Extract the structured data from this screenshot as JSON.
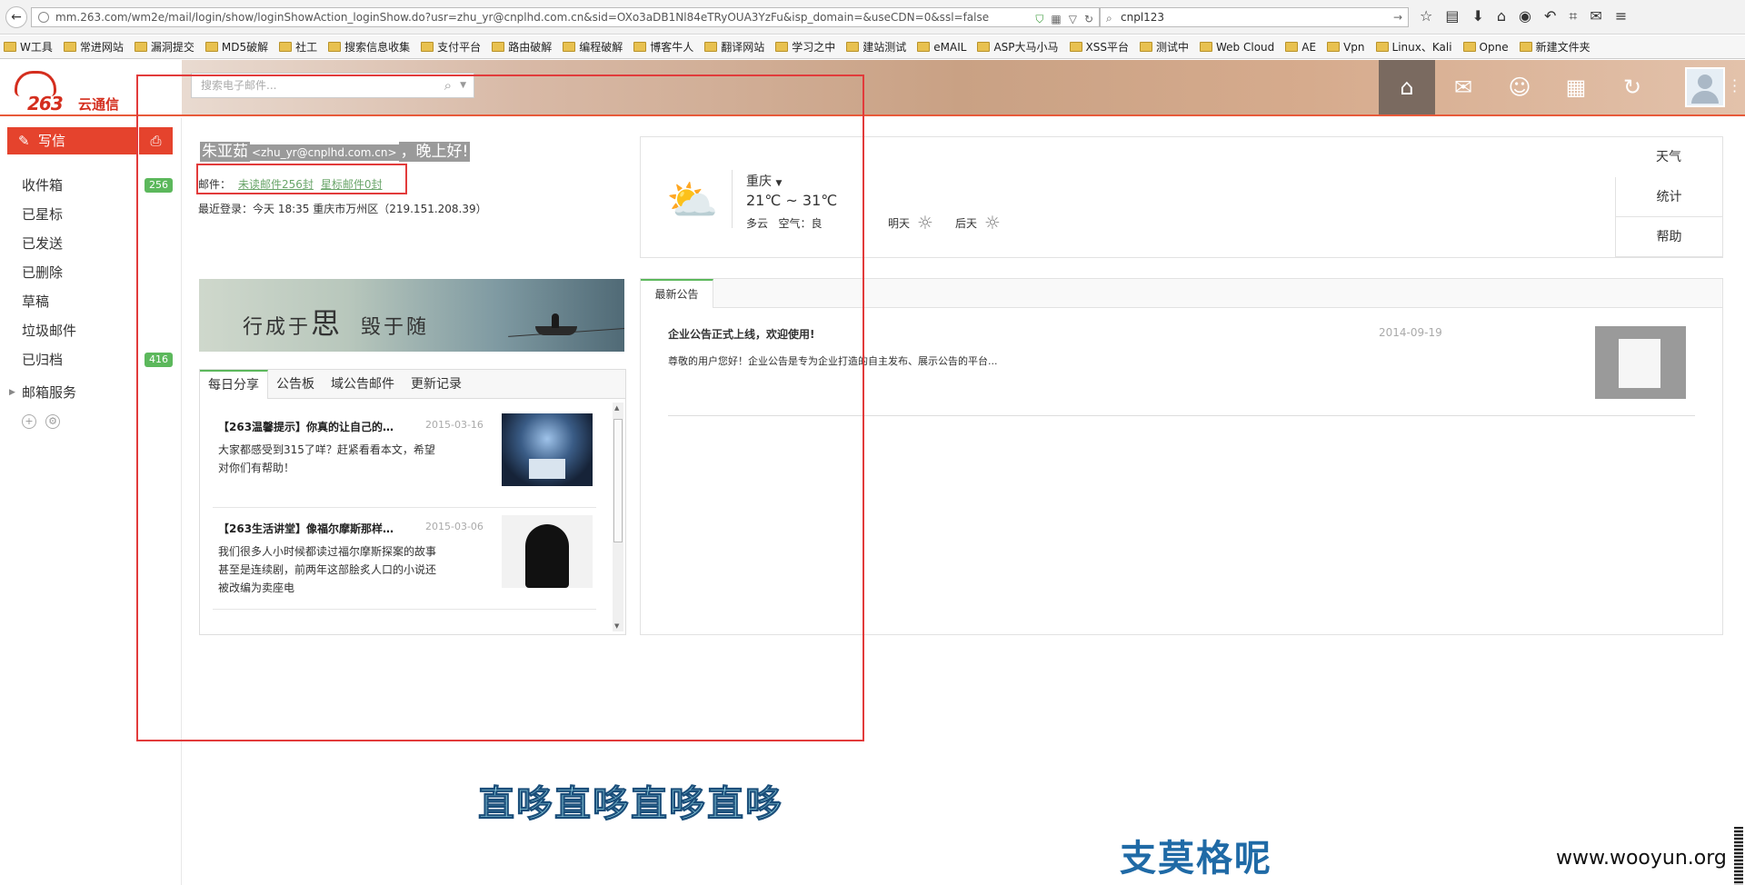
{
  "browser": {
    "url": "mm.263.com/wm2e/mail/login/show/loginShowAction_loginShow.do?usr=zhu_yr@cnplhd.com.cn&sid=OXo3aDB1Nl84eTRyOUA3YzFu&isp_domain=&useCDN=0&ssl=false",
    "search_value": "cnpl123",
    "bookmarks": [
      "W工具",
      "常进网站",
      "漏洞提交",
      "MD5破解",
      "社工",
      "搜索信息收集",
      "支付平台",
      "路由破解",
      "编程破解",
      "博客牛人",
      "翻译网站",
      "学习之中",
      "建站测试",
      "eMAIL",
      "ASP大马小马",
      "XSS平台",
      "测试中",
      "Web Cloud",
      "AE",
      "Vpn",
      "Linux、Kali",
      "Opne",
      "新建文件夹"
    ]
  },
  "header": {
    "logo_text": "263",
    "logo_sub": "云通信",
    "search_placeholder": "搜索电子邮件..."
  },
  "sidebar": {
    "compose_label": "写信",
    "folders": [
      {
        "label": "收件箱",
        "badge": "256"
      },
      {
        "label": "已星标",
        "badge": ""
      },
      {
        "label": "已发送",
        "badge": ""
      },
      {
        "label": "已删除",
        "badge": ""
      },
      {
        "label": "草稿",
        "badge": ""
      },
      {
        "label": "垃圾邮件",
        "badge": ""
      },
      {
        "label": "已归档",
        "badge": "416"
      }
    ],
    "service_label": "邮箱服务"
  },
  "main": {
    "user_name": "朱亚茹",
    "user_email": "<zhu_yr@cnplhd.com.cn>",
    "greeting": "，晚上好!",
    "mail_prefix": "邮件：",
    "unread_link": "未读邮件256封",
    "starred_link": "星标邮件0封",
    "last_login": "最近登录：今天 18:35 重庆市万州区（219.151.208.39）"
  },
  "banner": {
    "text_left": "行成于",
    "text_big": "思",
    "text_right": "毁于随"
  },
  "share": {
    "tabs": [
      "每日分享",
      "公告板",
      "域公告邮件",
      "更新记录"
    ],
    "items": [
      {
        "title": "【263温馨提示】你真的让自己的…",
        "date": "2015-03-16",
        "desc": "大家都感受到315了咩？赶紧看看本文，希望对你们有帮助！"
      },
      {
        "title": "【263生活讲堂】像福尔摩斯那样…",
        "date": "2015-03-06",
        "desc": "我们很多人小时候都读过福尔摩斯探案的故事甚至是连续剧，前两年这部脍炙人口的小说还被改编为卖座电"
      }
    ]
  },
  "weather": {
    "city": "重庆",
    "temp": "21℃ ~ 31℃",
    "condition": "多云",
    "air_label": "空气：",
    "air": "良",
    "tomorrow": "明天",
    "day_after": "后天",
    "tabs": [
      "天气",
      "统计",
      "帮助"
    ]
  },
  "notice": {
    "tab": "最新公告",
    "title": "企业公告正式上线，欢迎使用!",
    "date": "2014-09-19",
    "desc": "尊敬的用户您好！企业公告是专为企业打造的自主发布、展示公告的平台..."
  },
  "overlay": {
    "caption1": "直哆直哆直哆直哆",
    "caption2": "支莫格呢",
    "watermark": "www.wooyun.org"
  }
}
